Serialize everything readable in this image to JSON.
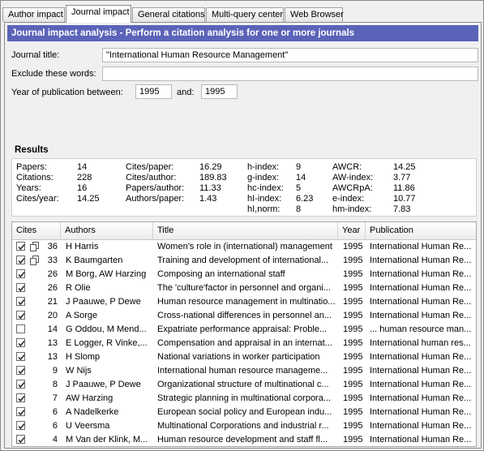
{
  "tabs": [
    "Author impact",
    "Journal impact",
    "General citations",
    "Multi-query center",
    "Web Browser"
  ],
  "banner": "Journal impact analysis - Perform a citation analysis for one or more journals",
  "form": {
    "journal_label": "Journal title:",
    "journal_value": "\"International Human Resource Management\"",
    "exclude_label": "Exclude these words:",
    "exclude_value": "",
    "year_label": "Year of publication between:",
    "year_from": "1995",
    "and_label": "and:",
    "year_to": "1995"
  },
  "results": {
    "title": "Results",
    "col1": [
      [
        "Papers:",
        "14"
      ],
      [
        "Citations:",
        "228"
      ],
      [
        "Years:",
        "16"
      ],
      [
        "Cites/year:",
        "14.25"
      ]
    ],
    "col2": [
      [
        "Cites/paper:",
        "16.29"
      ],
      [
        "Cites/author:",
        "189.83"
      ],
      [
        "Papers/author:",
        "11.33"
      ],
      [
        "Authors/paper:",
        "1.43"
      ]
    ],
    "col3": [
      [
        "h-index:",
        "9"
      ],
      [
        "g-index:",
        "14"
      ],
      [
        "hc-index:",
        "5"
      ],
      [
        "hI-index:",
        "6.23"
      ],
      [
        "hI,norm:",
        "8"
      ]
    ],
    "col4": [
      [
        "AWCR:",
        "14.25"
      ],
      [
        "AW-index:",
        "3.77"
      ],
      [
        "AWCRpA:",
        "11.86"
      ],
      [
        "e-index:",
        "10.77"
      ],
      [
        "hm-index:",
        "7.83"
      ]
    ]
  },
  "table": {
    "headers": [
      "Cites",
      "Authors",
      "Title",
      "Year",
      "Publication"
    ],
    "rows": [
      {
        "checked": true,
        "icon": true,
        "cites": "36",
        "authors": "H Harris",
        "title": "Women's role in (international) management",
        "year": "1995",
        "pub": "International Human Re..."
      },
      {
        "checked": true,
        "icon": true,
        "cites": "33",
        "authors": "K Baumgarten",
        "title": "Training and development of international...",
        "year": "1995",
        "pub": "International Human Re..."
      },
      {
        "checked": true,
        "icon": false,
        "cites": "26",
        "authors": "M Borg, AW Harzing",
        "title": "Composing an international staff",
        "year": "1995",
        "pub": "International Human Re..."
      },
      {
        "checked": true,
        "icon": false,
        "cites": "26",
        "authors": "R Olie",
        "title": "The 'culture'factor in personnel and organi...",
        "year": "1995",
        "pub": "International Human Re..."
      },
      {
        "checked": true,
        "icon": false,
        "cites": "21",
        "authors": "J Paauwe, P Dewe",
        "title": "Human resource management in multinatio...",
        "year": "1995",
        "pub": "International Human Re..."
      },
      {
        "checked": true,
        "icon": false,
        "cites": "20",
        "authors": "A Sorge",
        "title": "Cross-national differences in personnel an...",
        "year": "1995",
        "pub": "International Human Re..."
      },
      {
        "checked": false,
        "icon": false,
        "cites": "14",
        "authors": "G Oddou, M Mend...",
        "title": "Expatriate performance appraisal: Proble...",
        "year": "1995",
        "pub": "... human resource man..."
      },
      {
        "checked": true,
        "icon": false,
        "cites": "13",
        "authors": "E Logger, R Vinke,...",
        "title": "Compensation and appraisal in an internat...",
        "year": "1995",
        "pub": "International human res..."
      },
      {
        "checked": true,
        "icon": false,
        "cites": "13",
        "authors": "H Slomp",
        "title": "National variations in worker participation",
        "year": "1995",
        "pub": "International Human Re..."
      },
      {
        "checked": true,
        "icon": false,
        "cites": "9",
        "authors": "W Nijs",
        "title": "International human resource manageme...",
        "year": "1995",
        "pub": "International Human Re..."
      },
      {
        "checked": true,
        "icon": false,
        "cites": "8",
        "authors": "J Paauwe, P Dewe",
        "title": "Organizational structure of multinational c...",
        "year": "1995",
        "pub": "International Human Re..."
      },
      {
        "checked": true,
        "icon": false,
        "cites": "7",
        "authors": "AW Harzing",
        "title": "Strategic planning in multinational corpora...",
        "year": "1995",
        "pub": "International Human Re..."
      },
      {
        "checked": true,
        "icon": false,
        "cites": "6",
        "authors": "A Nadelkerke",
        "title": "European social policy and European indu...",
        "year": "1995",
        "pub": "International Human Re..."
      },
      {
        "checked": true,
        "icon": false,
        "cites": "6",
        "authors": "U Veersma",
        "title": "Multinational Corporations and industrial r...",
        "year": "1995",
        "pub": "International Human Re..."
      },
      {
        "checked": true,
        "icon": false,
        "cites": "4",
        "authors": "M Van der Klink, M...",
        "title": "Human resource development and staff fl...",
        "year": "1995",
        "pub": "International Human Re..."
      }
    ]
  }
}
